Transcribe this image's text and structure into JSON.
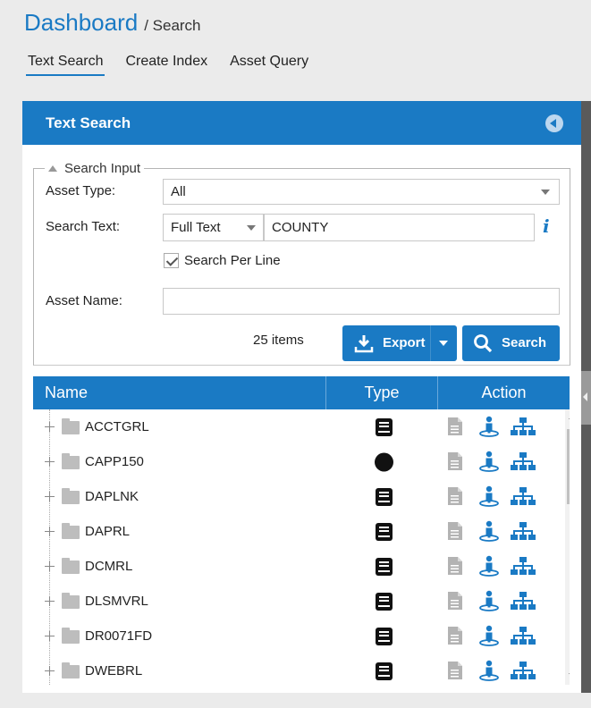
{
  "breadcrumb": {
    "home": "Dashboard",
    "current": "/ Search"
  },
  "tabs": [
    {
      "label": "Text Search",
      "active": true
    },
    {
      "label": "Create Index",
      "active": false
    },
    {
      "label": "Asset Query",
      "active": false
    }
  ],
  "panel": {
    "title": "Text Search"
  },
  "search_input": {
    "legend": "Search Input",
    "asset_type_label": "Asset Type:",
    "asset_type_value": "All",
    "search_text_label": "Search Text:",
    "search_mode": "Full Text",
    "search_text_value": "COUNTY",
    "search_per_line_label": "Search Per Line",
    "search_per_line_checked": true,
    "asset_name_label": "Asset Name:",
    "asset_name_value": ""
  },
  "results": {
    "count_text": "25 items",
    "export_label": "Export",
    "search_label": "Search"
  },
  "grid": {
    "columns": [
      "Name",
      "Type",
      "Action"
    ],
    "rows": [
      {
        "name": "ACCTGRL",
        "type_icon": "book-icon"
      },
      {
        "name": "CAPP150",
        "type_icon": "circle-icon"
      },
      {
        "name": "DAPLNK",
        "type_icon": "book-icon"
      },
      {
        "name": "DAPRL",
        "type_icon": "book-icon"
      },
      {
        "name": "DCMRL",
        "type_icon": "book-icon"
      },
      {
        "name": "DLSMVRL",
        "type_icon": "book-icon"
      },
      {
        "name": "DR0071FD",
        "type_icon": "book-icon"
      },
      {
        "name": "DWEBRL",
        "type_icon": "book-icon"
      }
    ]
  },
  "colors": {
    "accent": "#1a7ac4",
    "icon_gray": "#b3b3b3",
    "icon_dark": "#111111"
  }
}
